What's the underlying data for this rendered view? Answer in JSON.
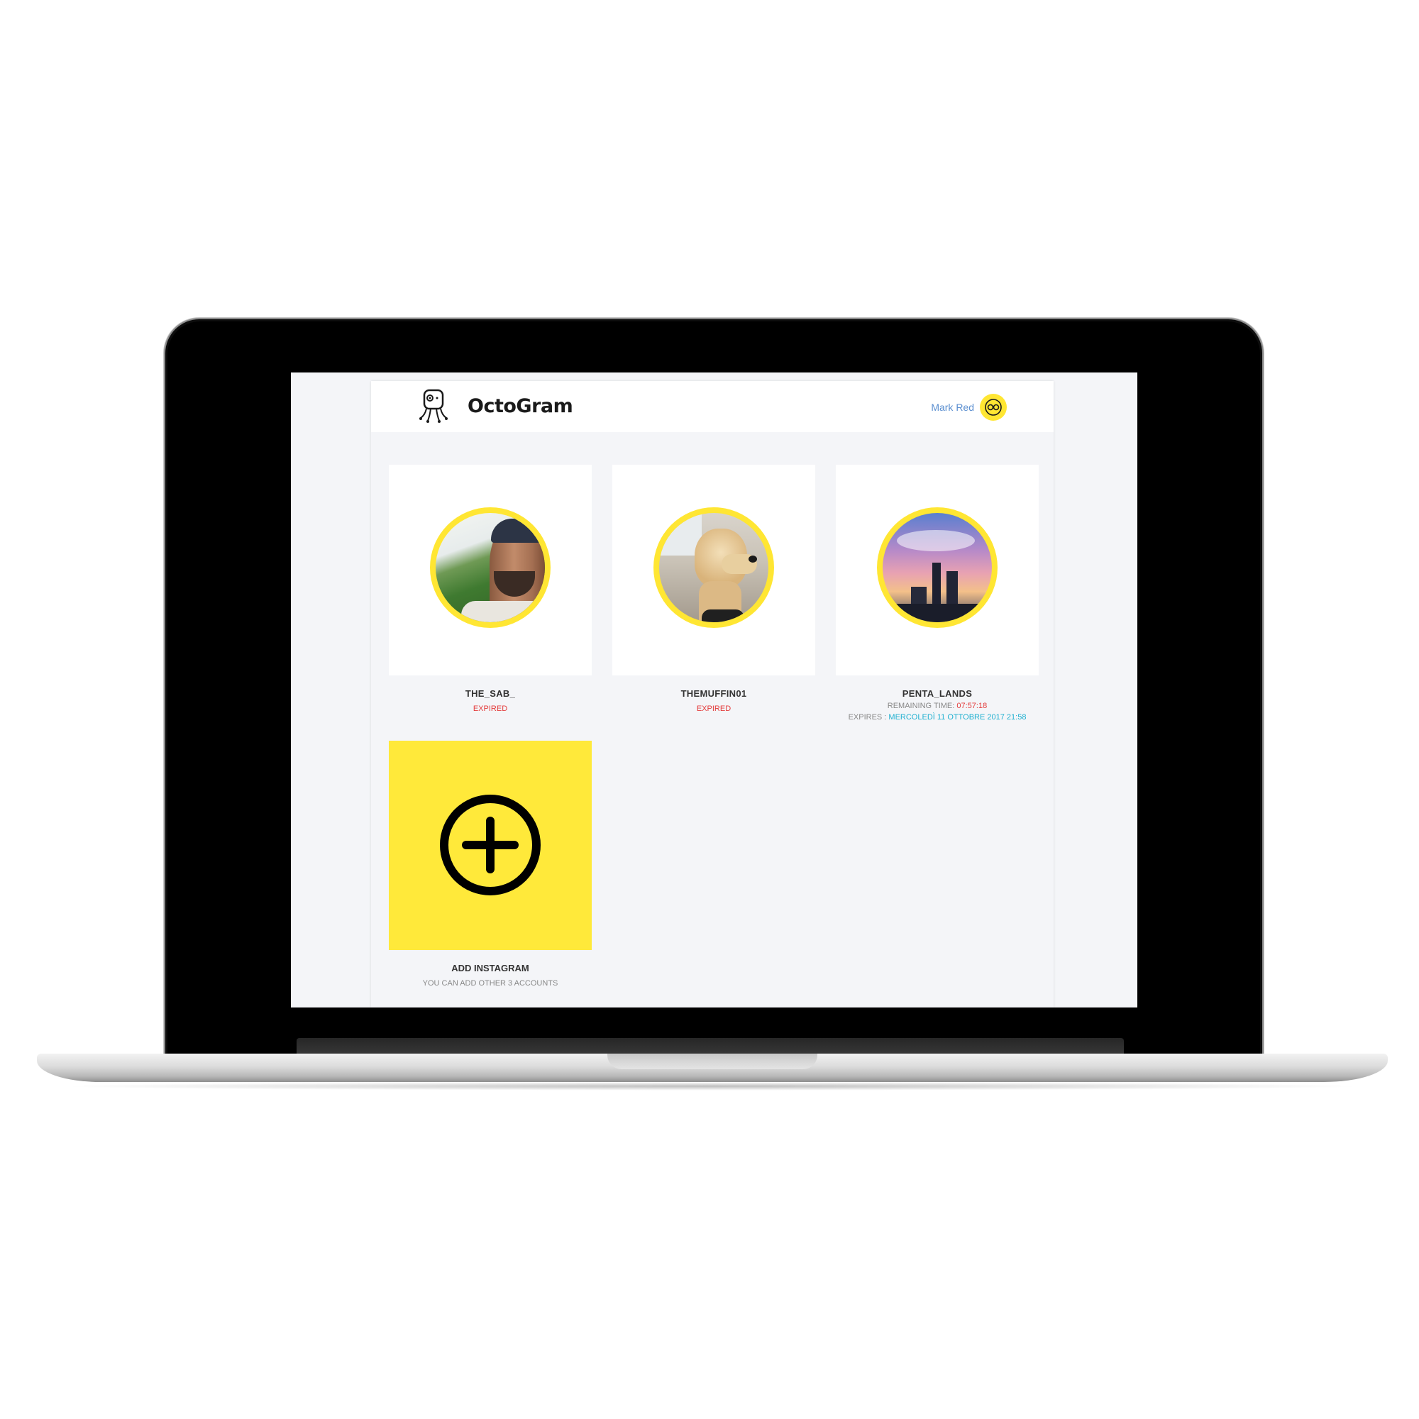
{
  "app": {
    "name": "OctoGram",
    "user": {
      "name": "Mark Red"
    }
  },
  "accounts": [
    {
      "username": "THE_SAB_",
      "status": "EXPIRED"
    },
    {
      "username": "THEMUFFIN01",
      "status": "EXPIRED"
    },
    {
      "username": "PENTA_LANDS",
      "remaining_label": "REMAINING TIME: ",
      "remaining_value": "07:57:18",
      "expires_label": "EXPIRES : ",
      "expires_value": "MERCOLEDÌ 11 OTTOBRE 2017 21:58"
    }
  ],
  "add_card": {
    "title": "ADD INSTAGRAM",
    "subtitle": "YOU CAN ADD OTHER 3 ACCOUNTS"
  },
  "colors": {
    "accent_yellow": "#ffe633",
    "expired_red": "#e33b3b",
    "date_cyan": "#1fb0d0",
    "user_link_blue": "#5b8fd0"
  },
  "icons": {
    "logo": "octopus-logo-icon",
    "avatar": "octopus-eyes-icon",
    "add": "plus-circle-icon"
  }
}
